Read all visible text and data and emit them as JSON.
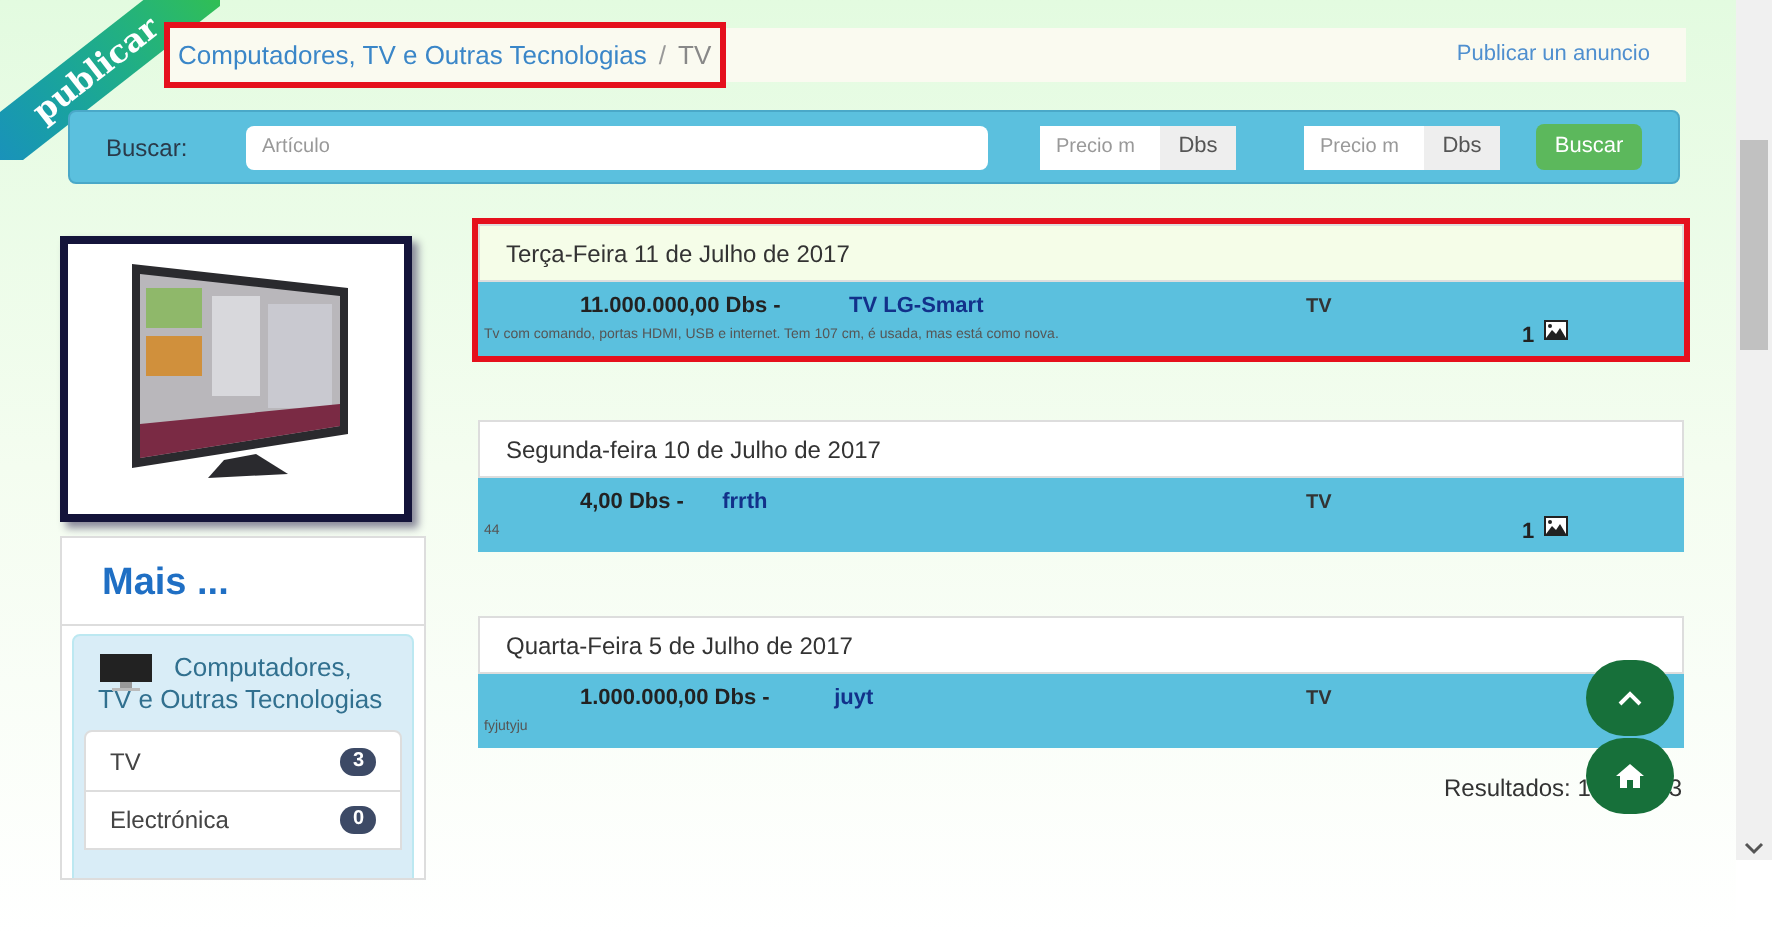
{
  "logo": {
    "text": "publicar"
  },
  "breadcrumb": {
    "separator": "/",
    "items": [
      {
        "label": "Computadores, TV e Outras Tecnologias",
        "selected": false
      },
      {
        "label": "TV",
        "selected": true
      }
    ],
    "highlighted": true
  },
  "publish_link": "Publicar un anuncio",
  "search": {
    "label": "Buscar:",
    "article": {
      "placeholder": "Artículo"
    },
    "price_min": {
      "placeholder": "Precio m",
      "unit": "Dbs"
    },
    "price_max": {
      "placeholder": "Precio m",
      "unit": "Dbs"
    },
    "button": "Buscar"
  },
  "sidebar": {
    "title": "Mais ...",
    "category": "Computadores, TV e Outras Tecnologias",
    "items": [
      {
        "label": "TV",
        "count": "3"
      },
      {
        "label": "Electrónica",
        "count": "0"
      }
    ]
  },
  "listings": [
    {
      "date": "Terça-Feira 11 de Julho de 2017",
      "price": "11.000.000,00 Dbs -",
      "title": "TV LG-Smart",
      "category": "TV",
      "description": "Tv com comando, portas HDMI, USB e internet. Tem 107 cm, é usada, mas está como nova.",
      "photos": "1",
      "highlighted": true
    },
    {
      "date": "Segunda-feira 10 de Julho de 2017",
      "price": "4,00 Dbs -",
      "title": "frrth",
      "category": "TV",
      "description": "44",
      "photos": "1",
      "highlighted": false
    },
    {
      "date": "Quarta-Feira 5 de Julho de 2017",
      "price": "1.000.000,00 Dbs -",
      "title": "juyt",
      "category": "TV",
      "description": "fyjutyju",
      "highlighted": false
    }
  ],
  "results": {
    "text": "Resultados: 1",
    "tail": "3"
  }
}
